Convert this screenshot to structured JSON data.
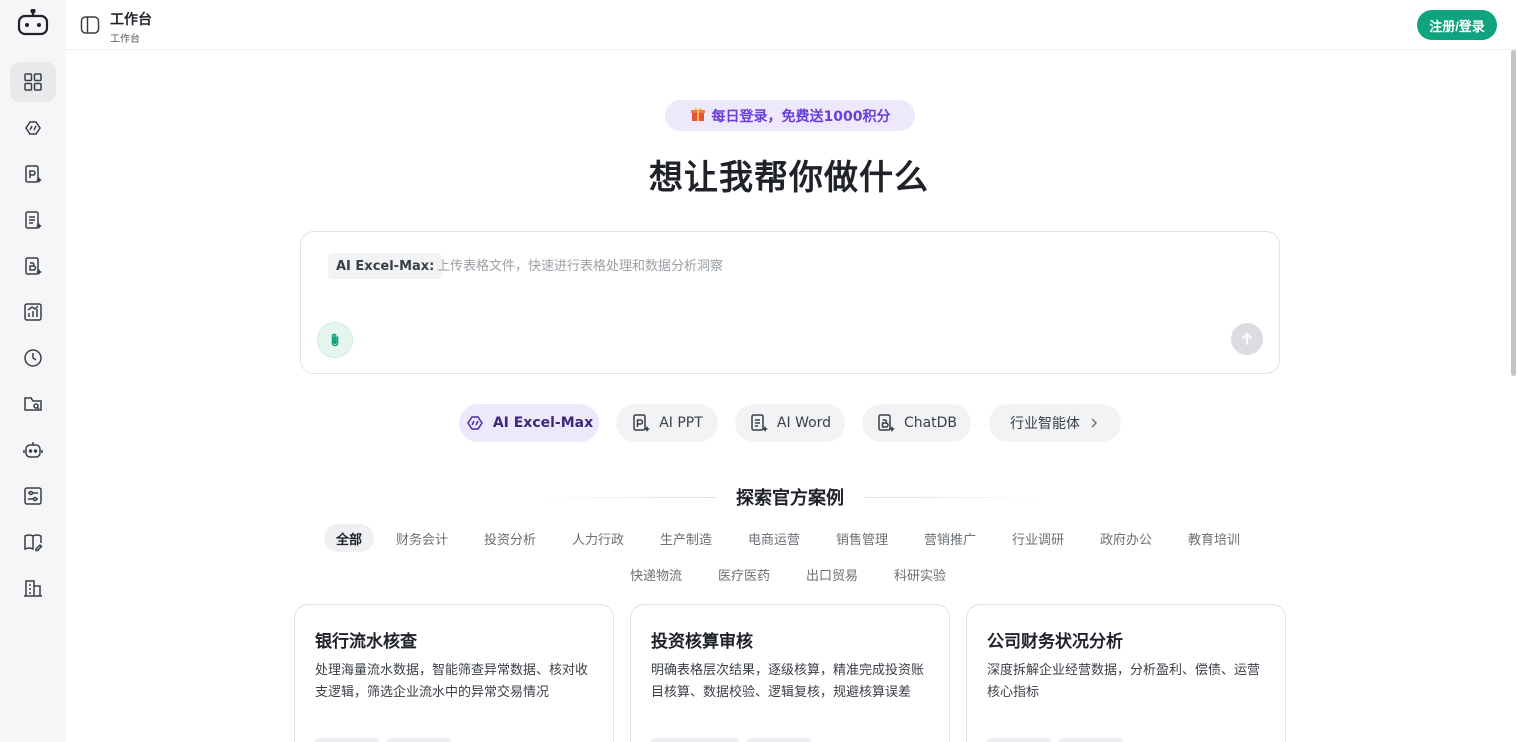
{
  "header": {
    "title": "工作台",
    "subtitle": "工作台",
    "login_label": "注册/登录"
  },
  "sidebar": {
    "items": [
      {
        "name": "workspace",
        "icon": "grid-icon",
        "active": true
      },
      {
        "name": "excel",
        "icon": "excel-ai-icon"
      },
      {
        "name": "ppt",
        "icon": "ppt-ai-icon"
      },
      {
        "name": "word",
        "icon": "doc-ai-icon"
      },
      {
        "name": "chatdb",
        "icon": "db-ai-icon"
      },
      {
        "name": "analytics",
        "icon": "chart-icon"
      },
      {
        "name": "history",
        "icon": "history-icon"
      },
      {
        "name": "files",
        "icon": "folder-icon"
      },
      {
        "name": "agents",
        "icon": "robot-icon"
      },
      {
        "name": "settings",
        "icon": "sliders-icon"
      },
      {
        "name": "docs",
        "icon": "book-icon"
      },
      {
        "name": "enterprise",
        "icon": "building-icon"
      }
    ]
  },
  "promo": {
    "icon": "gift-icon",
    "text": "每日登录，免费送1000积分"
  },
  "headline": "想让我帮你做什么",
  "composer": {
    "mode_label": "AI Excel-Max:",
    "placeholder": "上传表格文件，快速进行表格处理和数据分析洞察",
    "attach_icon": "paperclip-icon",
    "send_icon": "arrow-up-icon"
  },
  "tools": [
    {
      "label": "AI Excel-Max",
      "icon": "excel-ai-icon",
      "active": true
    },
    {
      "label": "AI PPT",
      "icon": "ppt-ai-icon"
    },
    {
      "label": "AI Word",
      "icon": "doc-ai-icon"
    },
    {
      "label": "ChatDB",
      "icon": "db-ai-icon"
    },
    {
      "label": "行业智能体",
      "icon": "chevron-right-icon"
    }
  ],
  "section_title": "探索官方案例",
  "categories": [
    "全部",
    "财务会计",
    "投资分析",
    "人力行政",
    "生产制造",
    "电商运营",
    "销售管理",
    "营销推广",
    "行业调研",
    "政府办公",
    "教育培训",
    "快递物流",
    "医疗医药",
    "出口贸易",
    "科研实验"
  ],
  "active_category": "全部",
  "cards": [
    {
      "title": "银行流水核查",
      "desc": "处理海量流水数据，智能筛查异常数据、核对收支逻辑，筛选企业流水中的异常交易情况"
    },
    {
      "title": "投资核算审核",
      "desc": "明确表格层次结果，逐级核算，精准完成投资账目核算、数据校验、逻辑复核，规避核算误差"
    },
    {
      "title": "公司财务状况分析",
      "desc": "深度拆解企业经营数据，分析盈利、偿债、运营核心指标"
    }
  ],
  "colors": {
    "brand_green": "#10a37f",
    "accent_purple": "#6a3fd9",
    "purple_bg": "#ede8fb"
  }
}
